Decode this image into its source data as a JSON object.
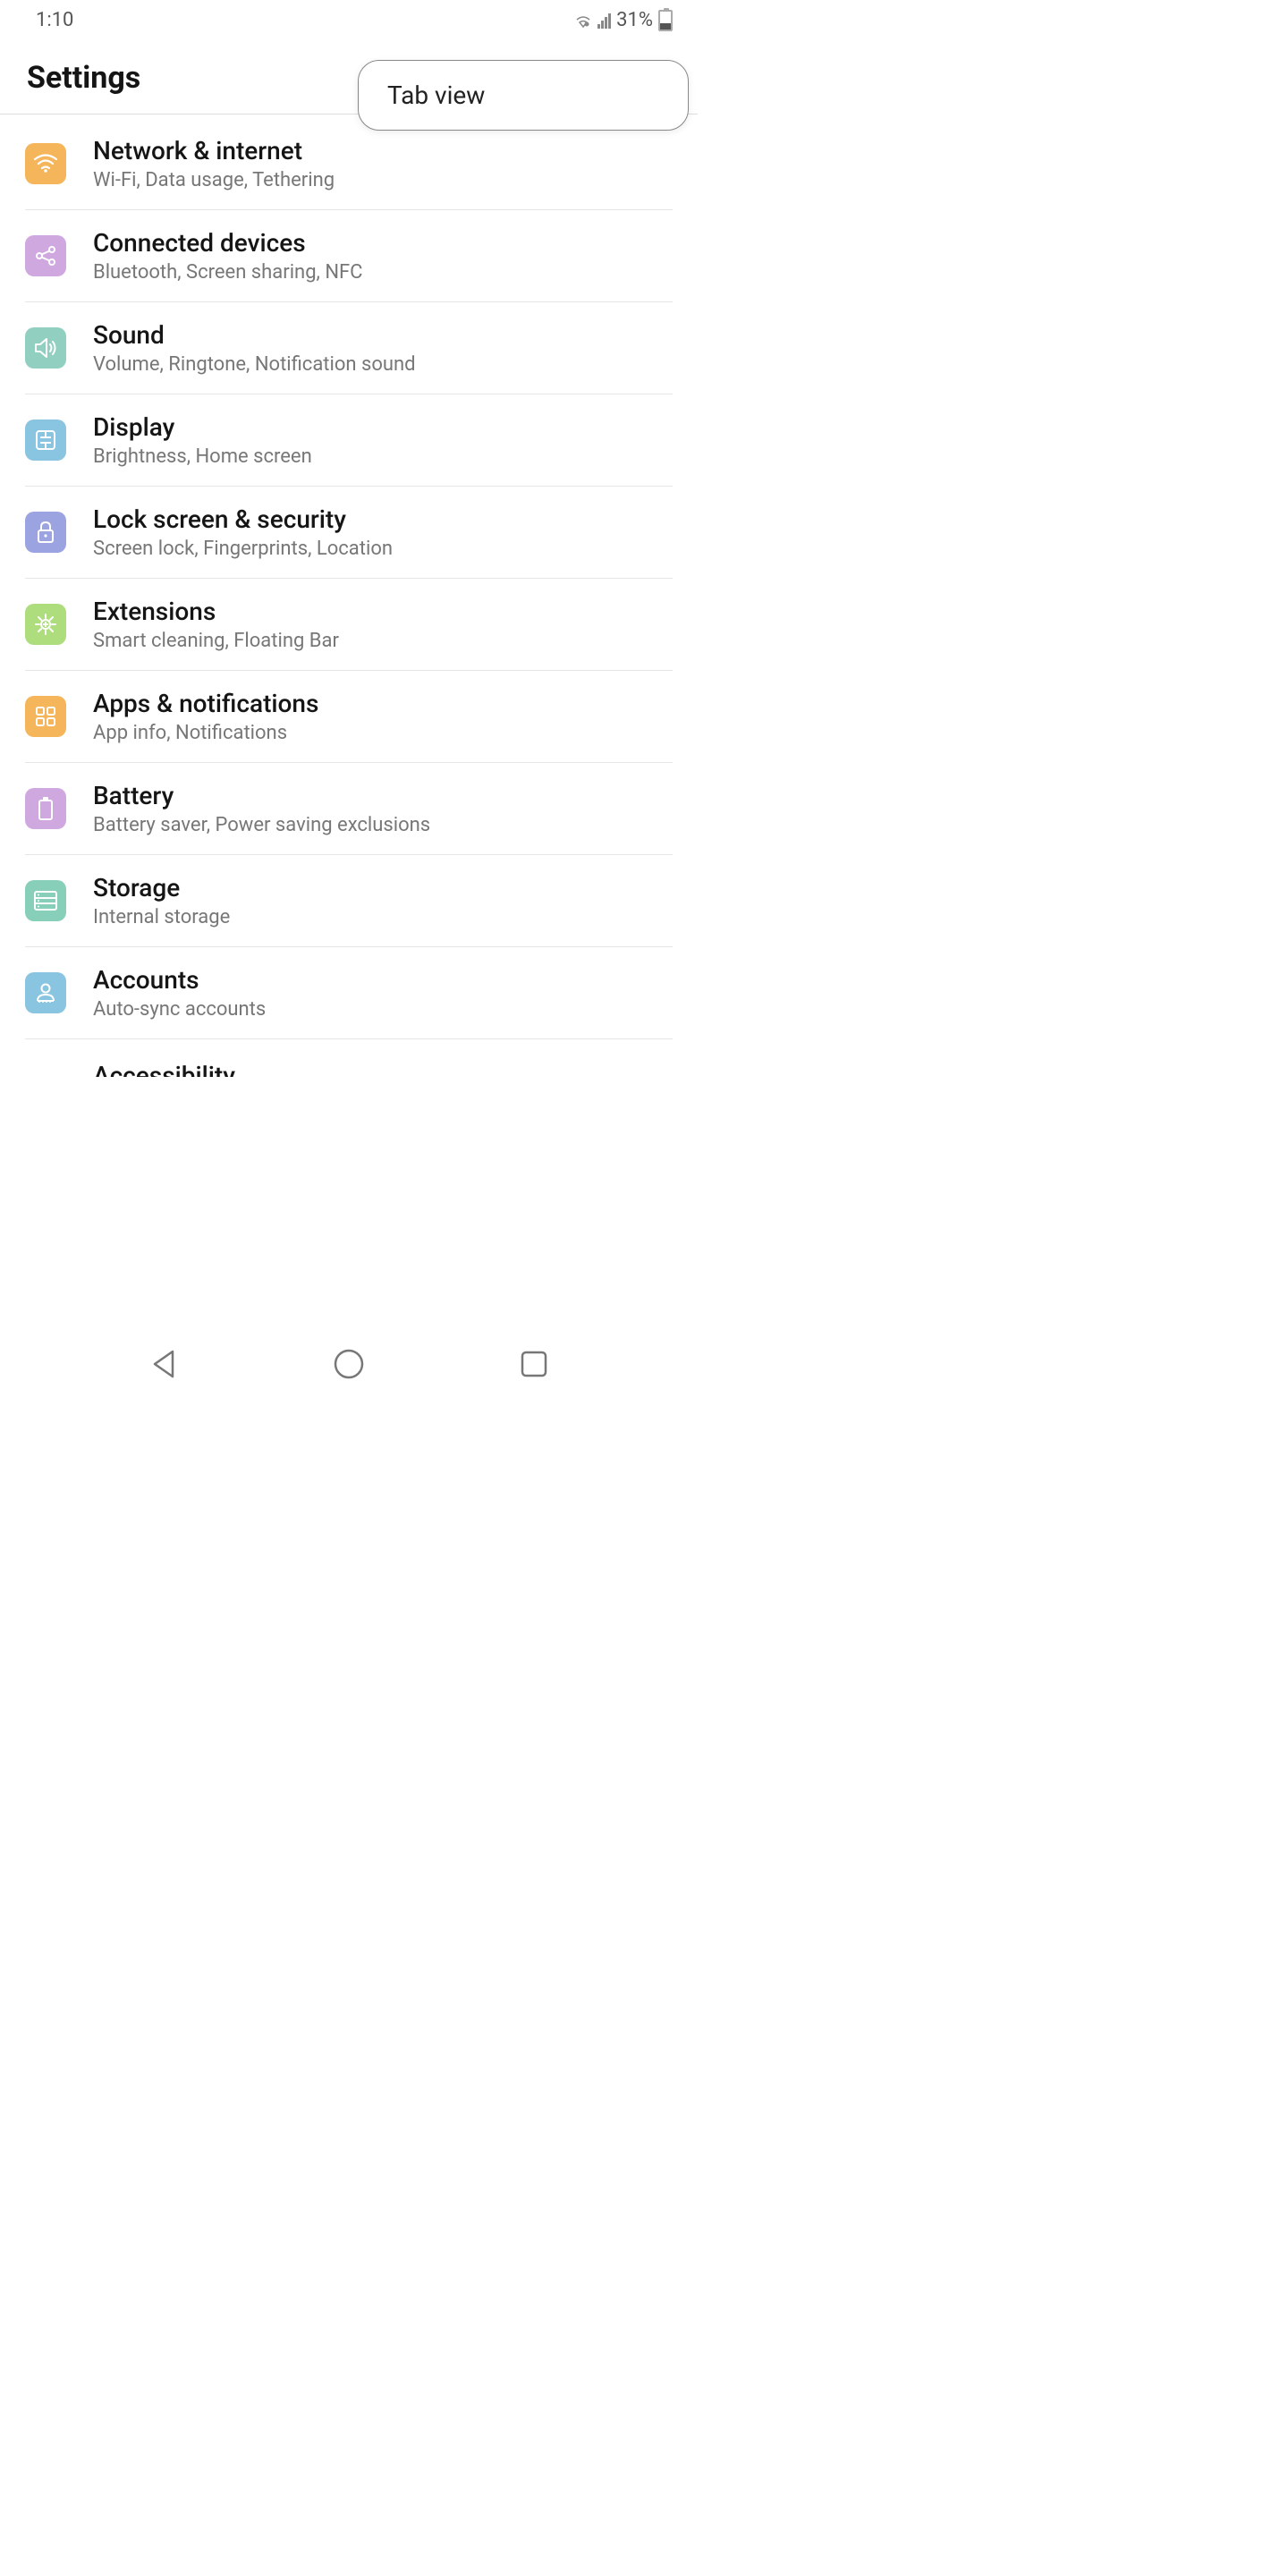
{
  "status": {
    "time": "1:10",
    "battery_percent": "31%"
  },
  "header": {
    "title": "Settings"
  },
  "popup": {
    "item": "Tab view"
  },
  "items": [
    {
      "title": "Network & internet",
      "sub": "Wi-Fi, Data usage, Tethering",
      "icon": "wifi",
      "color": "icon-orange"
    },
    {
      "title": "Connected devices",
      "sub": "Bluetooth, Screen sharing, NFC",
      "icon": "share",
      "color": "icon-purple"
    },
    {
      "title": "Sound",
      "sub": "Volume, Ringtone, Notification sound",
      "icon": "sound",
      "color": "icon-teal"
    },
    {
      "title": "Display",
      "sub": "Brightness, Home screen",
      "icon": "display",
      "color": "icon-blue-light"
    },
    {
      "title": "Lock screen & security",
      "sub": "Screen lock, Fingerprints, Location",
      "icon": "lock",
      "color": "icon-blue-violet"
    },
    {
      "title": "Extensions",
      "sub": "Smart cleaning, Floating Bar",
      "icon": "gear",
      "color": "icon-green"
    },
    {
      "title": "Apps & notifications",
      "sub": "App info, Notifications",
      "icon": "apps",
      "color": "icon-orange2"
    },
    {
      "title": "Battery",
      "sub": "Battery saver, Power saving exclusions",
      "icon": "battery",
      "color": "icon-purple2"
    },
    {
      "title": "Storage",
      "sub": "Internal storage",
      "icon": "storage",
      "color": "icon-teal2"
    },
    {
      "title": "Accounts",
      "sub": "Auto-sync accounts",
      "icon": "account",
      "color": "icon-blue-light2"
    }
  ],
  "partial_item": {
    "title": "Accessibility"
  }
}
